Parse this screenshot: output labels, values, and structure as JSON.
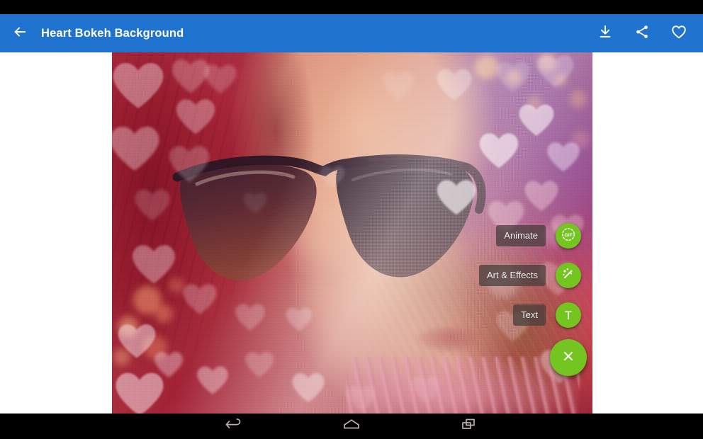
{
  "app": {
    "toolbar": {
      "title": "Heart Bokeh Background",
      "back_icon": "arrow-left-icon",
      "accent_color": "#1f73ce",
      "actions": [
        {
          "name": "download-button",
          "icon": "download-icon",
          "label": "Download"
        },
        {
          "name": "share-button",
          "icon": "share-icon",
          "label": "Share"
        },
        {
          "name": "favorite-button",
          "icon": "heart-outline-icon",
          "label": "Favorite"
        }
      ]
    },
    "wallpaper": {
      "name": "heart-bokeh-wallpaper",
      "alt": "Woman with sunglasses and red hair behind a pink and purple heart bokeh overlay"
    },
    "fab_menu": {
      "accent_color": "#74c520",
      "items": [
        {
          "label": "Animate",
          "icon": "gif-icon",
          "icon_text": "GIF"
        },
        {
          "label": "Art & Effects",
          "icon": "magic-wand-icon",
          "icon_text": ""
        },
        {
          "label": "Text",
          "icon": "text-t-icon",
          "icon_text": "T"
        }
      ],
      "close": {
        "label": "Close",
        "icon": "close-icon"
      }
    },
    "navbar": {
      "buttons": [
        {
          "name": "nav-back-button",
          "icon": "back-arrow-icon",
          "label": "Back"
        },
        {
          "name": "nav-home-button",
          "icon": "home-icon",
          "label": "Home"
        },
        {
          "name": "nav-recents-button",
          "icon": "recents-icon",
          "label": "Recent apps"
        }
      ]
    }
  }
}
